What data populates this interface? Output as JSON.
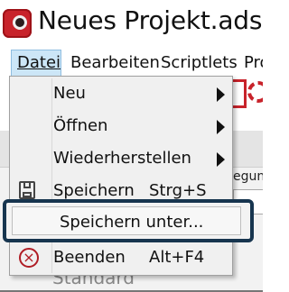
{
  "window": {
    "title": "Neues Projekt.ads* - A",
    "icon": "app-icon",
    "accent_color": "#c8232b"
  },
  "menubar": {
    "items": [
      {
        "label": "Datei",
        "active": true
      },
      {
        "label": "Bearbeiten",
        "active": false
      },
      {
        "label": "Scriptlets",
        "active": false
      },
      {
        "label": "Pro",
        "active": false
      }
    ]
  },
  "dropdown": {
    "items": [
      {
        "label": "Neu",
        "has_submenu": true
      },
      {
        "label": "Öffnen",
        "has_submenu": true
      },
      {
        "label": "Wiederherstellen",
        "has_submenu": true
      },
      {
        "label": "Speichern",
        "shortcut": "Strg+S",
        "icon": "save-icon"
      },
      {
        "label": "Speichern unter...",
        "highlighted": true
      },
      {
        "label": "Beenden",
        "shortcut": "Alt+F4",
        "icon": "exit-icon"
      }
    ],
    "highlight_color": "#17354f"
  },
  "background": {
    "fragment_text": "egun",
    "standard_text": "Standard"
  }
}
